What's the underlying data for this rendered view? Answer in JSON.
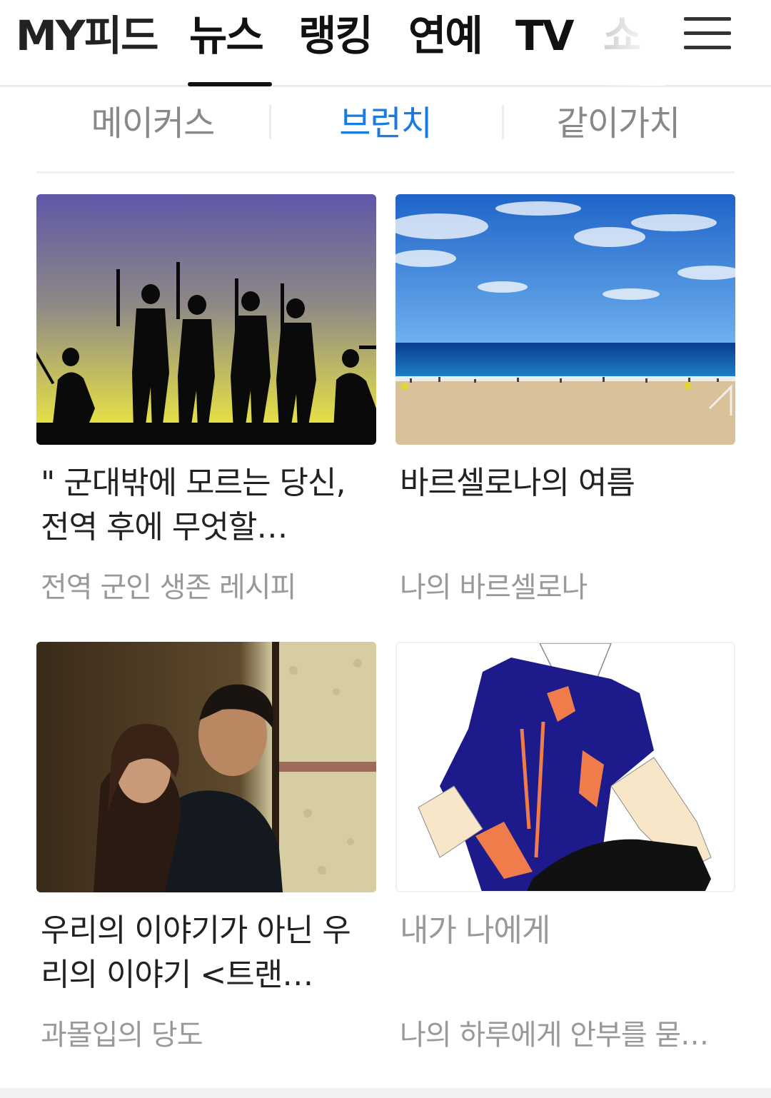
{
  "nav": {
    "tabs": [
      {
        "label": "MY피드"
      },
      {
        "label": "뉴스"
      },
      {
        "label": "랭킹"
      },
      {
        "label": "연예"
      },
      {
        "label": "TV"
      },
      {
        "label": "쇼"
      }
    ],
    "active_tab": "뉴스",
    "menu_icon": "hamburger-menu-icon"
  },
  "subtabs": {
    "items": [
      {
        "label": "메이커스"
      },
      {
        "label": "브런치"
      },
      {
        "label": "같이가치"
      }
    ],
    "active": "브런치",
    "active_color": "#1a7ce0"
  },
  "cards": [
    {
      "title": "\" 군대밖에 모르는 당신, 전역 후에 무엇할…",
      "source": "전역 군인 생존 레시피"
    },
    {
      "title": "바르셀로나의 여름",
      "source": "나의 바르셀로나"
    },
    {
      "title": "우리의 이야기가 아닌 우리의 이야기 <트랜…",
      "source": "과몰입의 당도"
    },
    {
      "title": "내가 나에게",
      "source": "나의 하루에게 안부를 묻…"
    }
  ]
}
